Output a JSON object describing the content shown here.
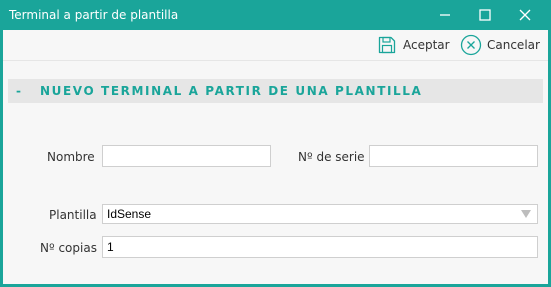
{
  "window": {
    "title": "Terminal a partir de plantilla",
    "title_bg": "#1aa59a"
  },
  "toolbar": {
    "accept_label": "Aceptar",
    "accept_icon": "save-icon",
    "cancel_label": "Cancelar",
    "cancel_icon": "close-circle-icon"
  },
  "section": {
    "toggle": "-",
    "title": "NUEVO TERMINAL A PARTIR DE UNA PLANTILLA",
    "accent": "#1aa59a"
  },
  "form": {
    "nombre_label": "Nombre",
    "nombre_value": "",
    "serie_label": "Nº de serie",
    "serie_value": "",
    "plantilla_label": "Plantilla",
    "plantilla_value": "IdSense",
    "copias_label": "Nº copias",
    "copias_value": "1"
  }
}
